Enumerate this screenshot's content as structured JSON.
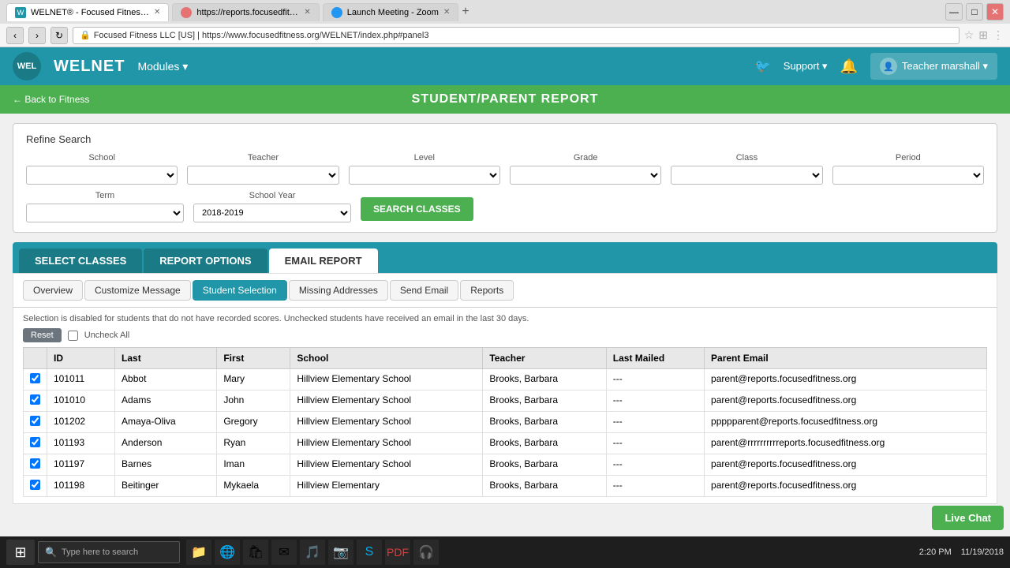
{
  "browser": {
    "tabs": [
      {
        "label": "WELNET® - Focused Fitness, LLC",
        "active": true,
        "icon": "welnet"
      },
      {
        "label": "https://reports.focusedfitness.c...",
        "active": false,
        "icon": "report"
      },
      {
        "label": "Launch Meeting - Zoom",
        "active": false,
        "icon": "zoom"
      }
    ],
    "address": "Focused Fitness LLC [US] | https://www.focusedfitness.org/WELNET/index.php#panel3"
  },
  "topnav": {
    "logo": "WEL",
    "app_name": "WELNET",
    "modules_label": "Modules ▾",
    "support_label": "Support ▾",
    "teacher_label": "Teacher marshall ▾"
  },
  "greenbar": {
    "back_label": "← Back to Fitness",
    "page_title": "STUDENT/PARENT REPORT"
  },
  "refine": {
    "title": "Refine Search",
    "fields": {
      "school_label": "School",
      "teacher_label": "Teacher",
      "level_label": "Level",
      "grade_label": "Grade",
      "class_label": "Class",
      "period_label": "Period",
      "term_label": "Term",
      "school_year_label": "School Year",
      "school_year_value": "2018-2019"
    },
    "search_btn": "SEARCH CLASSES"
  },
  "tabs": {
    "items": [
      {
        "label": "SELECT CLASSES",
        "active": false
      },
      {
        "label": "REPORT OPTIONS",
        "active": false
      },
      {
        "label": "EMAIL REPORT",
        "active": true
      }
    ],
    "sub_tabs": [
      {
        "label": "Overview",
        "active": false
      },
      {
        "label": "Customize Message",
        "active": false
      },
      {
        "label": "Student Selection",
        "active": true
      },
      {
        "label": "Missing Addresses",
        "active": false
      },
      {
        "label": "Send Email",
        "active": false
      },
      {
        "label": "Reports",
        "active": false
      }
    ]
  },
  "table": {
    "info": "Selection is disabled for students that do not have recorded scores. Unchecked students have received an email in the last 30 days.",
    "reset_btn": "Reset",
    "uncheck_all": "Uncheck All",
    "columns": [
      "ID",
      "Last",
      "First",
      "School",
      "Teacher",
      "Last Mailed",
      "Parent Email"
    ],
    "rows": [
      {
        "checked": true,
        "id": "101011",
        "last": "Abbot",
        "first": "Mary",
        "school": "Hillview Elementary School",
        "teacher": "Brooks, Barbara",
        "last_mailed": "---",
        "email": "parent@reports.focusedfitness.org"
      },
      {
        "checked": true,
        "id": "101010",
        "last": "Adams",
        "first": "John",
        "school": "Hillview Elementary School",
        "teacher": "Brooks, Barbara",
        "last_mailed": "---",
        "email": "parent@reports.focusedfitness.org"
      },
      {
        "checked": true,
        "id": "101202",
        "last": "Amaya-Oliva",
        "first": "Gregory",
        "school": "Hillview Elementary School",
        "teacher": "Brooks, Barbara",
        "last_mailed": "---",
        "email": "ppppparent@reports.focusedfitness.org"
      },
      {
        "checked": true,
        "id": "101193",
        "last": "Anderson",
        "first": "Ryan",
        "school": "Hillview Elementary School",
        "teacher": "Brooks, Barbara",
        "last_mailed": "---",
        "email": "parent@rrrrrrrrrreports.focusedfitness.org"
      },
      {
        "checked": true,
        "id": "101197",
        "last": "Barnes",
        "first": "Iman",
        "school": "Hillview Elementary School",
        "teacher": "Brooks, Barbara",
        "last_mailed": "---",
        "email": "parent@reports.focusedfitness.org"
      },
      {
        "checked": true,
        "id": "101198",
        "last": "Beitinger",
        "first": "Mykaela",
        "school": "Hillview Elementary",
        "teacher": "Brooks, Barbara",
        "last_mailed": "---",
        "email": "parent@reports.focusedfitness.org"
      }
    ]
  },
  "live_chat": "Live Chat",
  "taskbar": {
    "search_placeholder": "Type here to search",
    "time": "2:20 PM",
    "date": "11/19/2018"
  }
}
